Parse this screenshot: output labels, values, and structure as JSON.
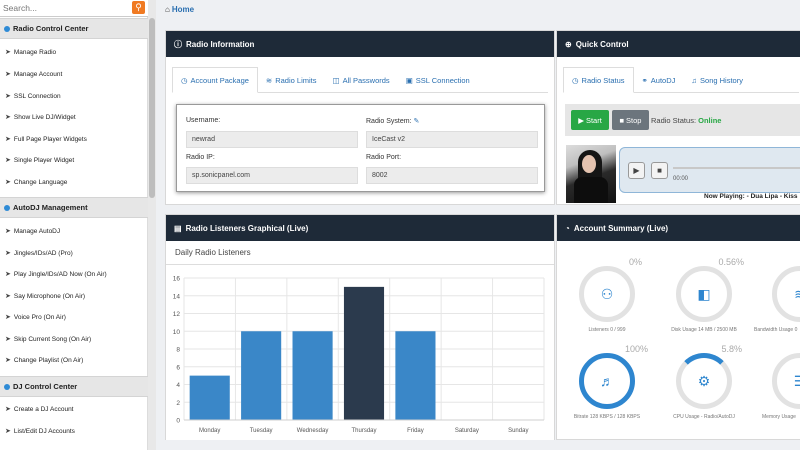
{
  "sidebar": {
    "search_placeholder": "Search...",
    "sections": [
      {
        "title": "Radio Control Center",
        "items": [
          "Manage Radio",
          "Manage Account",
          "SSL Connection",
          "Show Live DJ/Widget",
          "Full Page Player Widgets",
          "Single Player Widget",
          "Change Language"
        ]
      },
      {
        "title": "AutoDJ Management",
        "items": [
          "Manage AutoDJ",
          "Jingles/IDs/AD (Pro)",
          "Play Jingle/IDs/AD Now (On Air)",
          "Say Microphone (On Air)",
          "Voice Pro (On Air)",
          "Skip Current Song (On Air)",
          "Change Playlist (On Air)"
        ]
      },
      {
        "title": "DJ Control Center",
        "items": [
          "Create a DJ Account",
          "List/Edit DJ Accounts"
        ]
      }
    ]
  },
  "breadcrumb": {
    "home": "Home"
  },
  "radio_info": {
    "title": "Radio Information",
    "tabs": [
      "Account Package",
      "Radio Limits",
      "All Passwords",
      "SSL Connection"
    ],
    "fields": {
      "username_label": "Username:",
      "username": "newrad",
      "system_label": "Radio System:",
      "system": "IceCast v2",
      "ip_label": "Radio IP:",
      "ip": "sp.sonicpanel.com",
      "port_label": "Radio Port:",
      "port": "8002"
    }
  },
  "quick_control": {
    "title": "Quick Control",
    "tabs": [
      "Radio Status",
      "AutoDJ",
      "Song History"
    ],
    "start_label": "Start",
    "stop_label": "Stop",
    "status_label": "Radio Status:",
    "status_value": "Online",
    "player_time": "00:00",
    "now_playing": "Now Playing: - Dua Lipa - Kiss"
  },
  "listeners": {
    "title": "Radio Listeners Graphical (Live)",
    "chart_title": "Daily Radio Listeners"
  },
  "chart_data": {
    "type": "bar",
    "title": "Daily Radio Listeners",
    "categories": [
      "Monday",
      "Tuesday",
      "Wednesday",
      "Thursday",
      "Friday",
      "Saturday",
      "Sunday"
    ],
    "values": [
      5,
      10,
      10,
      15,
      10,
      0,
      0
    ],
    "ylim": [
      0,
      16
    ],
    "yticks": [
      0,
      2,
      4,
      6,
      8,
      10,
      12,
      14,
      16
    ],
    "grid": true,
    "highlight_index": 3,
    "bar_color": "#3a87c8",
    "highlight_color": "#2b3a4d"
  },
  "summary": {
    "title": "Account Summary (Live)",
    "gauges": [
      {
        "pct": "0%",
        "caption": "Listeners 0 / 999",
        "icon": "users-icon",
        "state": "empty"
      },
      {
        "pct": "0.56%",
        "caption": "Disk Usage 14 MB / 2500 MB",
        "icon": "hdd-icon",
        "state": "empty"
      },
      {
        "pct": "",
        "caption": "Bandwidth Usage 0",
        "icon": "chart-icon",
        "state": "empty"
      },
      {
        "pct": "100%",
        "caption": "Bitrate 128 KBPS / 128 KBPS",
        "icon": "volume-icon",
        "state": "full"
      },
      {
        "pct": "5.8%",
        "caption": "CPU Usage - Radio/AutoDJ",
        "icon": "gear-icon",
        "state": "partial"
      },
      {
        "pct": "",
        "caption": "Memory Usage",
        "icon": "memory-icon",
        "state": "empty"
      }
    ]
  }
}
